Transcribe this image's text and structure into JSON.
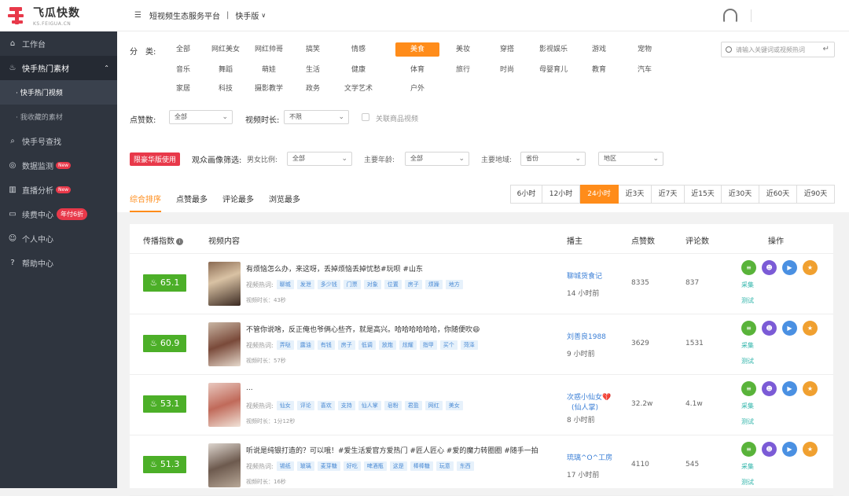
{
  "app": {
    "brand": "飞瓜快数",
    "brand_sub": "KS.FEIGUA.CN"
  },
  "sidebar": {
    "items": [
      {
        "label": "工作台",
        "icon": "home-icon"
      },
      {
        "label": "快手热门素材",
        "icon": "fire-icon"
      },
      {
        "label": "快手号查找",
        "icon": "search-icon"
      },
      {
        "label": "数据监测",
        "icon": "monitor-icon",
        "badge": "New"
      },
      {
        "label": "直播分析",
        "icon": "bar-chart-icon",
        "badge": "New"
      },
      {
        "label": "续费中心",
        "icon": "card-icon",
        "badge": "年付6折"
      },
      {
        "label": "个人中心",
        "icon": "user-icon"
      },
      {
        "label": "帮助中心",
        "icon": "help-icon"
      }
    ],
    "sub_items": [
      "· 快手热门视频",
      "· 我收藏的素材"
    ]
  },
  "topbar": {
    "title": "短视频生态服务平台",
    "separator": "|",
    "version": "快手版"
  },
  "filters": {
    "category_label": "分　类:",
    "categories": [
      "全部",
      "网红美女",
      "网红帅哥",
      "搞笑",
      "情感",
      "美食",
      "美妆",
      "穿搭",
      "影视娱乐",
      "游戏",
      "宠物",
      "音乐",
      "舞蹈",
      "萌娃",
      "生活",
      "健康",
      "体育",
      "旅行",
      "时尚",
      "母婴育儿",
      "教育",
      "汽车",
      "家居",
      "科技",
      "摄影教学",
      "政务",
      "文学艺术",
      "户外"
    ],
    "search_placeholder": "请输入关键词或视频热词",
    "likes_label": "点赞数:",
    "likes_value": "全部",
    "duration_label": "视频时长:",
    "duration_value": "不限",
    "goods_label": "关联商品视频",
    "pro_badge": "限豪华版使用",
    "audience_label": "观众画像筛选:",
    "gender_label": "男女比例:",
    "gender_value": "全部",
    "age_label": "主要年龄:",
    "age_value": "全部",
    "region_label": "主要地域:",
    "province_value": "省份",
    "area_value": "地区",
    "sort_tabs": [
      "综合排序",
      "点赞最多",
      "评论最多",
      "浏览最多"
    ],
    "time_tabs": [
      "6小时",
      "12小时",
      "24小时",
      "近3天",
      "近7天",
      "近15天",
      "近30天",
      "近60天",
      "近90天"
    ]
  },
  "table": {
    "headers": {
      "score": "传播指数",
      "content": "视频内容",
      "author": "播主",
      "likes": "点赞数",
      "comments": "评论数",
      "actions": "操作"
    },
    "hot_label": "视频热词:",
    "actions": {
      "collect": "采集",
      "test": "测试"
    },
    "rows": [
      {
        "score": "65.1",
        "title": "有烦恼怎么办，来这呀，丢掉烦恼丢掉忧愁#玩呗 #山东",
        "tags": [
          "聊城",
          "发泄",
          "多少钱",
          "门票",
          "对象",
          "位置",
          "房子",
          "烦躁",
          "地方"
        ],
        "duration": "视频时长：43秒",
        "author": "聊城货食记",
        "author2": "",
        "time": "14 小时前",
        "likes": "8335",
        "comments": "837"
      },
      {
        "score": "60.9",
        "title": "不管你说啥，反正俺也爷俩心些齐，就是高兴。哈哈哈哈哈哈，你随便吹😄",
        "tags": [
          "弄哒",
          "露油",
          "有钱",
          "房子",
          "低调",
          "放炮",
          "炫耀",
          "指甲",
          "买个",
          "菏泽"
        ],
        "duration": "视频时长：57秒",
        "author": "刘善良1988",
        "author2": "",
        "time": "9 小时前",
        "likes": "3629",
        "comments": "1531"
      },
      {
        "score": "53.1",
        "title": "...",
        "tags": [
          "仙女",
          "评论",
          "喜欢",
          "支持",
          "仙人掌",
          "皂粉",
          "君盈",
          "网红",
          "美女"
        ],
        "duration": "视频时长：1分12秒",
        "author": "次惑小仙女💔",
        "author2": "(仙人掌)",
        "time": "8 小时前",
        "likes": "32.2w",
        "comments": "4.1w"
      },
      {
        "score": "51.3",
        "title": "听说是纯银打造的？可以哦！#爱生活爱官方爱热门 #匠人匠心 #爱的魔力转圈圈 #随手一拍",
        "tags": [
          "锡纸",
          "玻璃",
          "麦芽糖",
          "好吃",
          "啤酒瓶",
          "这是",
          "棒棒糖",
          "玩意",
          "东西"
        ],
        "duration": "视频时长：16秒",
        "author": "琉璃^O^工房",
        "author2": "",
        "time": "17 小时前",
        "likes": "4110",
        "comments": "545"
      }
    ]
  },
  "colors": {
    "accent": "#ff8c1a",
    "score_green": "#4caf28",
    "sidebar": "#2f353f",
    "brand_red": "#e8394a"
  }
}
